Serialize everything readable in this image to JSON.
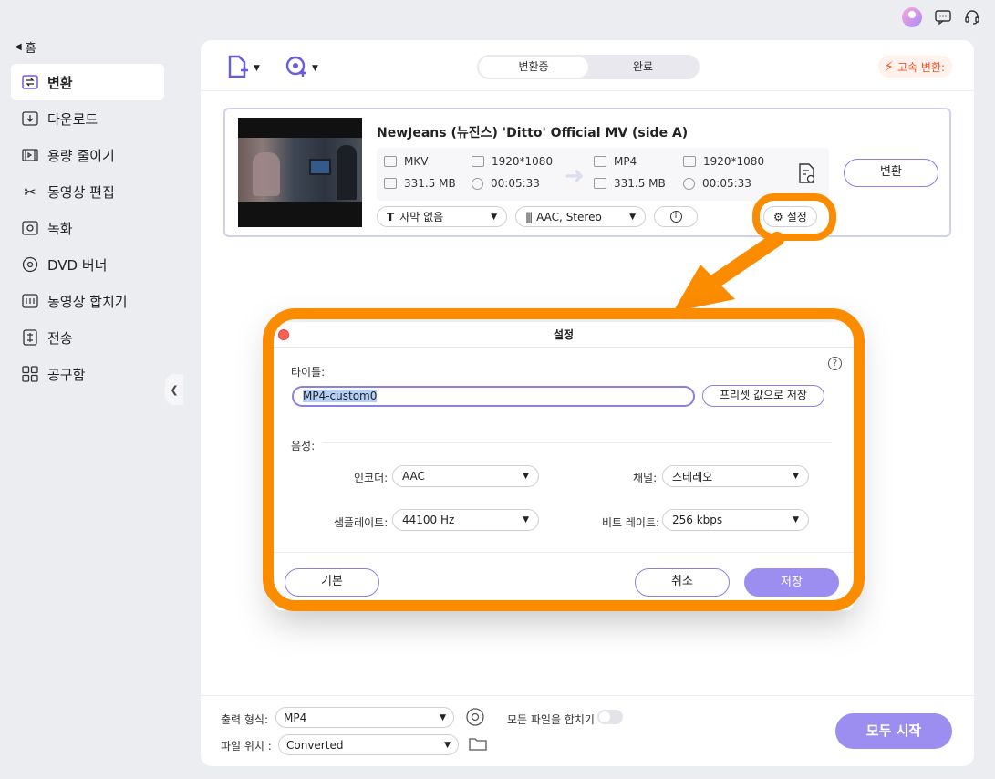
{
  "sidebar": {
    "back_label": "홈",
    "items": [
      {
        "label": "변환",
        "icon": "convert-icon"
      },
      {
        "label": "다운로드",
        "icon": "download-icon"
      },
      {
        "label": "용량 줄이기",
        "icon": "compress-icon"
      },
      {
        "label": "동영상 편집",
        "icon": "scissors-icon"
      },
      {
        "label": "녹화",
        "icon": "record-icon"
      },
      {
        "label": "DVD 버너",
        "icon": "disc-icon"
      },
      {
        "label": "동영상 합치기",
        "icon": "merge-icon"
      },
      {
        "label": "전송",
        "icon": "transfer-icon"
      },
      {
        "label": "공구함",
        "icon": "toolbox-icon"
      }
    ]
  },
  "toolbar": {
    "tabs": [
      "변환중",
      "완료"
    ],
    "speed_label": "고속 변환:",
    "accent": "#8b7fe0",
    "speed_color": "#f05522"
  },
  "file": {
    "title": "NewJeans (뉴진스) 'Ditto' Official MV (side A)",
    "src_format": "MKV",
    "src_resolution": "1920*1080",
    "src_size": "331.5 MB",
    "src_duration": "00:05:33",
    "dst_format": "MP4",
    "dst_resolution": "1920*1080",
    "dst_size": "331.5 MB",
    "dst_duration": "00:05:33",
    "subtitle": "자막 없음",
    "audio": "AAC, Stereo",
    "settings_label": "설정",
    "convert_label": "변환"
  },
  "dialog": {
    "title": "설정",
    "help": "?",
    "title_label": "타이틀:",
    "title_value": "MP4-custom0",
    "preset_button": "프리셋 값으로 저장",
    "audio_label": "음성:",
    "encoder_label": "인코더:",
    "encoder_value": "AAC",
    "channel_label": "채널:",
    "channel_value": "스테레오",
    "samplerate_label": "샘플레이트:",
    "samplerate_value": "44100 Hz",
    "bitrate_label": "비트 레이트:",
    "bitrate_value": "256 kbps",
    "default_button": "기본",
    "cancel_button": "취소",
    "save_button": "저장"
  },
  "bottom": {
    "output_label": "출력 형식:",
    "output_value": "MP4",
    "merge_label": "모든 파일을 합치기",
    "location_label": "파일 위치 :",
    "location_value": "Converted",
    "start_all": "모두 시작"
  },
  "highlight_color": "#fb8c00"
}
